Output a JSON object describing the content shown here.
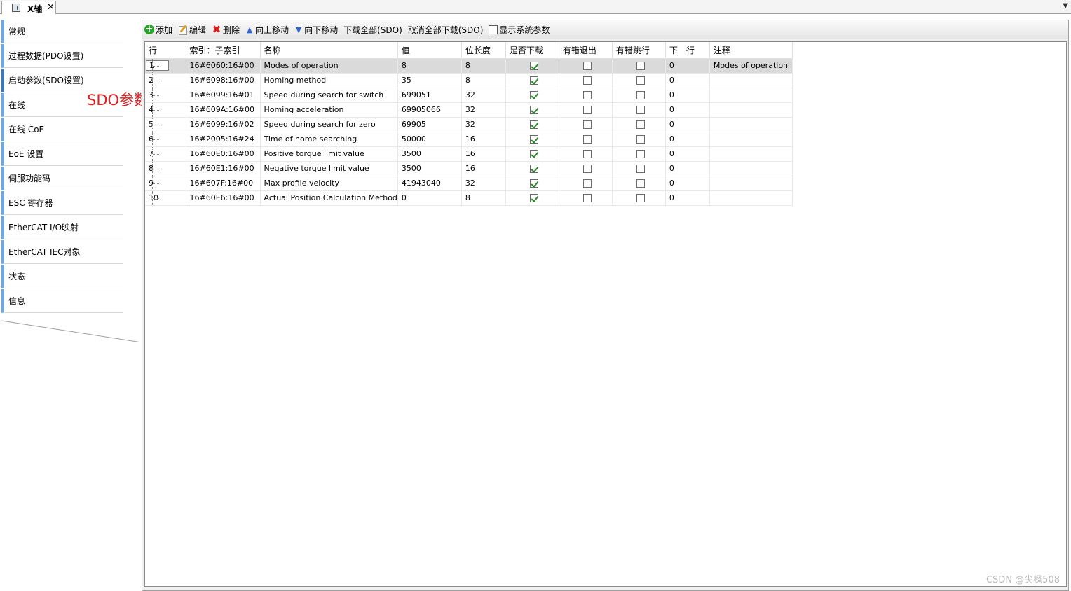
{
  "tab": {
    "title": "X轴",
    "close": "✕",
    "dropdown": "▼"
  },
  "sidebar": {
    "items": [
      {
        "label": "常规"
      },
      {
        "label": "过程数据(PDO设置)"
      },
      {
        "label": "启动参数(SDO设置)"
      },
      {
        "label": "在线"
      },
      {
        "label": "在线 CoE"
      },
      {
        "label": "EoE 设置"
      },
      {
        "label": "伺服功能码"
      },
      {
        "label": "ESC 寄存器"
      },
      {
        "label": "EtherCAT I/O映射"
      },
      {
        "label": "EtherCAT IEC对象"
      },
      {
        "label": "状态"
      },
      {
        "label": "信息"
      }
    ],
    "active_index": 2,
    "annotation": "SDO参数",
    "annotation_color": "#e02020"
  },
  "toolbar": {
    "add_label": "添加",
    "edit_label": "编辑",
    "delete_label": "删除",
    "move_up_label": "向上移动",
    "move_down_label": "向下移动",
    "download_all_label": "下载全部(SDO)",
    "cancel_download_all_label": "取消全部下载(SDO)",
    "show_system_params_label": "显示系统参数",
    "show_system_params_checked": false
  },
  "table": {
    "columns": [
      "行",
      "索引：子索引",
      "名称",
      "值",
      "位长度",
      "是否下载",
      "有错退出",
      "有错跳行",
      "下一行",
      "注释"
    ],
    "rows": [
      {
        "line": "1",
        "index": "16#6060:16#00",
        "name": "Modes of operation",
        "value": "8",
        "bitlen": "8",
        "download": true,
        "abort_on_error": false,
        "jump_on_error": false,
        "next_line": "0",
        "comment": "Modes of operation"
      },
      {
        "line": "2",
        "index": "16#6098:16#00",
        "name": "Homing method",
        "value": "35",
        "bitlen": "8",
        "download": true,
        "abort_on_error": false,
        "jump_on_error": false,
        "next_line": "0",
        "comment": ""
      },
      {
        "line": "3",
        "index": "16#6099:16#01",
        "name": "Speed during search for switch",
        "value": "699051",
        "bitlen": "32",
        "download": true,
        "abort_on_error": false,
        "jump_on_error": false,
        "next_line": "0",
        "comment": ""
      },
      {
        "line": "4",
        "index": "16#609A:16#00",
        "name": "Homing acceleration",
        "value": "69905066",
        "bitlen": "32",
        "download": true,
        "abort_on_error": false,
        "jump_on_error": false,
        "next_line": "0",
        "comment": ""
      },
      {
        "line": "5",
        "index": "16#6099:16#02",
        "name": "Speed during search for zero",
        "value": "69905",
        "bitlen": "32",
        "download": true,
        "abort_on_error": false,
        "jump_on_error": false,
        "next_line": "0",
        "comment": ""
      },
      {
        "line": "6",
        "index": "16#2005:16#24",
        "name": "Time of home searching",
        "value": "50000",
        "bitlen": "16",
        "download": true,
        "abort_on_error": false,
        "jump_on_error": false,
        "next_line": "0",
        "comment": ""
      },
      {
        "line": "7",
        "index": "16#60E0:16#00",
        "name": "Positive torque limit value",
        "value": "3500",
        "bitlen": "16",
        "download": true,
        "abort_on_error": false,
        "jump_on_error": false,
        "next_line": "0",
        "comment": ""
      },
      {
        "line": "8",
        "index": "16#60E1:16#00",
        "name": "Negative torque limit value",
        "value": "3500",
        "bitlen": "16",
        "download": true,
        "abort_on_error": false,
        "jump_on_error": false,
        "next_line": "0",
        "comment": ""
      },
      {
        "line": "9",
        "index": "16#607F:16#00",
        "name": "Max profile velocity",
        "value": "41943040",
        "bitlen": "32",
        "download": true,
        "abort_on_error": false,
        "jump_on_error": false,
        "next_line": "0",
        "comment": ""
      },
      {
        "line": "10",
        "index": "16#60E6:16#00",
        "name": "Actual Position Calculation Method",
        "value": "0",
        "bitlen": "8",
        "download": true,
        "abort_on_error": false,
        "jump_on_error": false,
        "next_line": "0",
        "comment": ""
      }
    ],
    "selected_row": 0
  },
  "watermark": "CSDN @尖枫508"
}
